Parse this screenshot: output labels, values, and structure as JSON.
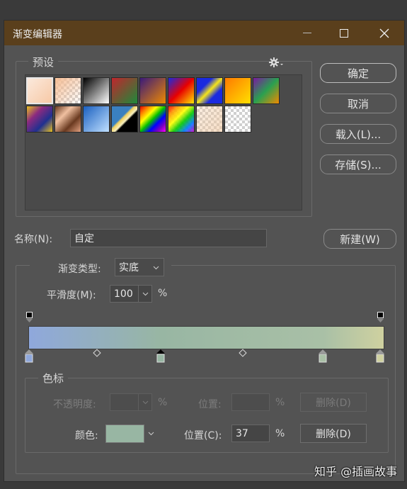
{
  "window": {
    "title": "渐变编辑器"
  },
  "buttons": {
    "ok": "确定",
    "cancel": "取消",
    "load": "载入(L)...",
    "save": "存储(S)...",
    "new": "新建(W)"
  },
  "presets": {
    "legend": "预设",
    "gear_icon": "gear-icon"
  },
  "name": {
    "label": "名称(N):",
    "value": "自定"
  },
  "gradient": {
    "type_label": "渐变类型:",
    "type_value": "实底",
    "smooth_label": "平滑度(M):",
    "smooth_value": "100",
    "smooth_unit": "%",
    "colors": [
      "#8fa8dc",
      "#98b6a3",
      "#a9c0a6",
      "#cfd1a0"
    ]
  },
  "stops": {
    "legend": "色标",
    "opacity_label": "不透明度:",
    "opacity_value": "",
    "opacity_unit": "%",
    "location_label_1": "位置:",
    "location_value_1": "",
    "location_unit_1": "%",
    "delete_1": "删除(D)",
    "color_label": "颜色:",
    "color_value": "#98b6a3",
    "location_label_2": "位置(C):",
    "location_value_2": "37",
    "location_unit_2": "%",
    "delete_2": "删除(D)"
  },
  "watermark": "知乎 @插画故事"
}
